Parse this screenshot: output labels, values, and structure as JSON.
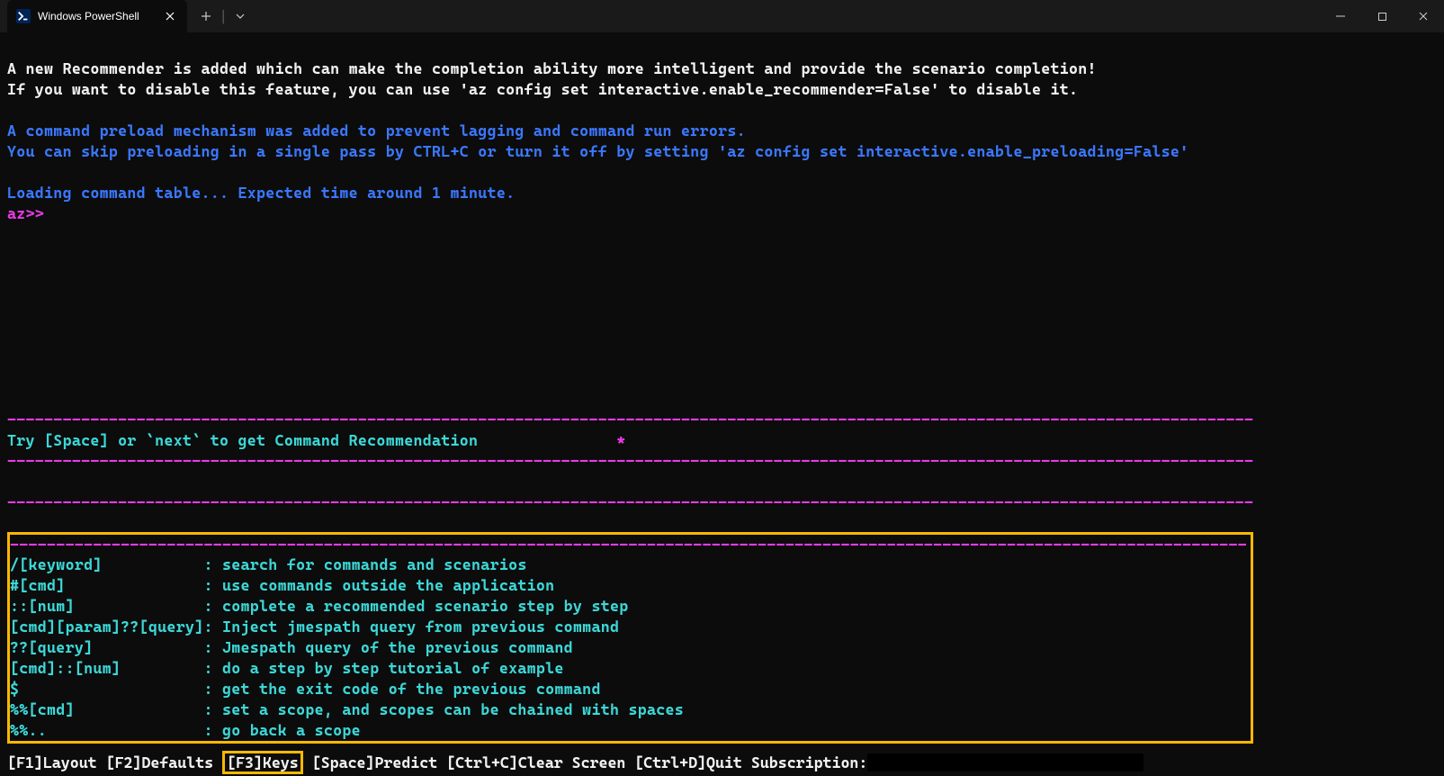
{
  "titlebar": {
    "tab_title": "Windows PowerShell"
  },
  "output": {
    "line1": "A new Recommender is added which can make the completion ability more intelligent and provide the scenario completion!",
    "line2": "If you want to disable this feature, you can use 'az config set interactive.enable_recommender=False' to disable it.",
    "line3": "A command preload mechanism was added to prevent lagging and command run errors.",
    "line4": "You can skip preloading in a single pass by CTRL+C or turn it off by setting 'az config set interactive.enable_preloading=False'",
    "line5": "Loading command table... Expected time around 1 minute.",
    "prompt": "az>>"
  },
  "dividers": {
    "dash": "---------------------------------------------------------------------------------------------------------------------------------------"
  },
  "recommendation": {
    "text": "Try [Space] or `next` to get Command Recommendation",
    "star": "*"
  },
  "help": [
    {
      "key": "/[keyword]",
      "desc": ": search for commands and scenarios"
    },
    {
      "key": "#[cmd]",
      "desc": ": use commands outside the application"
    },
    {
      "key": "::[num]",
      "desc": ": complete a recommended scenario step by step"
    },
    {
      "key": "[cmd][param]??[query]",
      "desc": ": Inject jmespath query from previous command"
    },
    {
      "key": "??[query]",
      "desc": ": Jmespath query of the previous command"
    },
    {
      "key": "[cmd]::[num]",
      "desc": ": do a step by step tutorial of example"
    },
    {
      "key": "$",
      "desc": ": get the exit code of the previous command"
    },
    {
      "key": "%%[cmd]",
      "desc": ": set a scope, and scopes can be chained with spaces"
    },
    {
      "key": "%%..",
      "desc": ": go back a scope"
    }
  ],
  "footer": {
    "f1": "[F1]Layout",
    "f2": "[F2]Defaults",
    "f3": "[F3]Keys",
    "space": "[Space]Predict",
    "ctrlc": "[Ctrl+C]Clear Screen",
    "ctrld": "[Ctrl+D]Quit",
    "sub_label": "Subscription:"
  }
}
